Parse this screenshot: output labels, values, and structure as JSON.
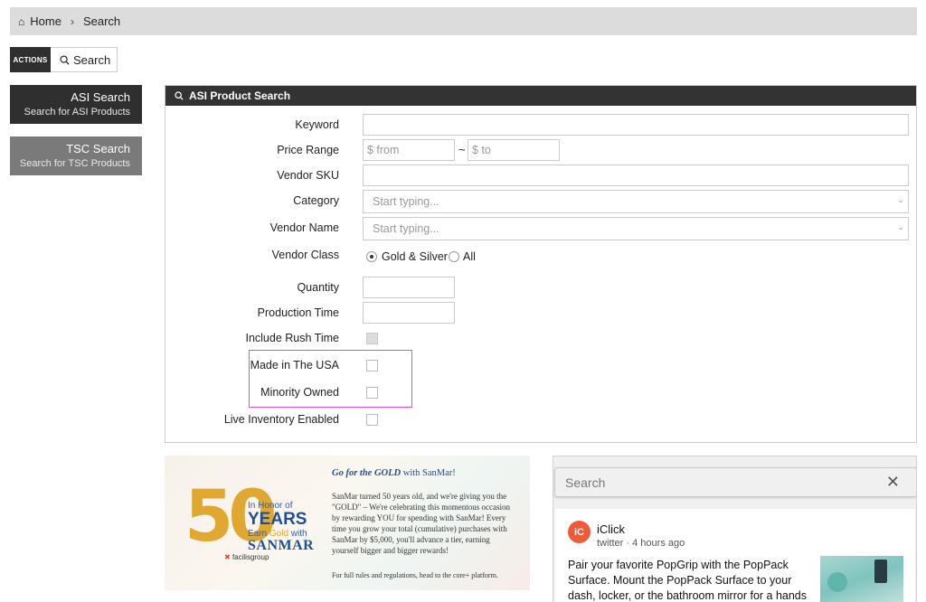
{
  "breadcrumb": {
    "home": "Home",
    "separator": "›",
    "current": "Search"
  },
  "actions": {
    "label": "ACTIONS",
    "search_label": "Search"
  },
  "sidebar": {
    "items": [
      {
        "title": "ASI Search",
        "subtitle": "Search for ASI Products",
        "active": true
      },
      {
        "title": "TSC Search",
        "subtitle": "Search for TSC Products",
        "active": false
      }
    ]
  },
  "panel": {
    "title": "ASI Product Search",
    "fields": {
      "keyword": {
        "label": "Keyword",
        "value": "",
        "placeholder": ""
      },
      "price_range": {
        "label": "Price Range",
        "from_placeholder": "$ from",
        "separator": "~",
        "to_placeholder": "$ to"
      },
      "vendor_sku": {
        "label": "Vendor SKU",
        "value": ""
      },
      "category": {
        "label": "Category",
        "placeholder": "Start typing..."
      },
      "vendor_name": {
        "label": "Vendor Name",
        "placeholder": "Start typing..."
      },
      "vendor_class": {
        "label": "Vendor Class",
        "options": [
          "Gold & Silver",
          "All"
        ],
        "selected": "Gold & Silver"
      },
      "quantity": {
        "label": "Quantity",
        "value": ""
      },
      "production_time": {
        "label": "Production Time",
        "value": ""
      },
      "include_rush_time": {
        "label": "Include Rush Time",
        "checked": false,
        "disabled": true
      },
      "made_in_usa": {
        "label": "Made in The USA",
        "checked": false
      },
      "minority_owned": {
        "label": "Minority Owned",
        "checked": false
      },
      "live_inventory": {
        "label": "Live Inventory Enabled",
        "checked": false
      }
    }
  },
  "banner": {
    "big_number": "50",
    "honor_text": "In Honor of",
    "years_text": "YEARS",
    "earn_text_pre": "Earn ",
    "earn_text_gold": "Gold",
    "earn_text_post": " with",
    "brand": "SANMAR",
    "partner_prefix": "✖ ",
    "partner": "facilisgroup",
    "headline_pre": "Go for the GOLD",
    "headline_post": " with SanMar!",
    "body": "SanMar turned 50 years old, and we're giving you the \"GOLD\" – We're celebrating this momentous occasion by rewarding YOU for spending with SanMar! Every time you grow your total (cumulative) purchases with SanMar by $5,000, you'll advance a tier, earning yourself bigger and bigger rewards!",
    "footnote": "For full rules and regulations, head to the core+ platform."
  },
  "feed": {
    "search_placeholder": "Search",
    "clear_symbol": "✕",
    "post": {
      "avatar_text": "iC",
      "author": "iClick",
      "source": "twitter",
      "time": "4 hours ago",
      "meta_separator": " · ",
      "text": "Pair your favorite PopGrip with the PopPack Surface. Mount the PopPack Surface to your dash, locker, or the bathroom mirror for a hands"
    }
  },
  "colors": {
    "dark_tile": "#2f2f2f",
    "gray_tile": "#7a7a7a",
    "header_bar": "#333333",
    "highlight": "#e24ae0",
    "gold": "#e0a830",
    "brand_blue": "#1f4f96"
  }
}
